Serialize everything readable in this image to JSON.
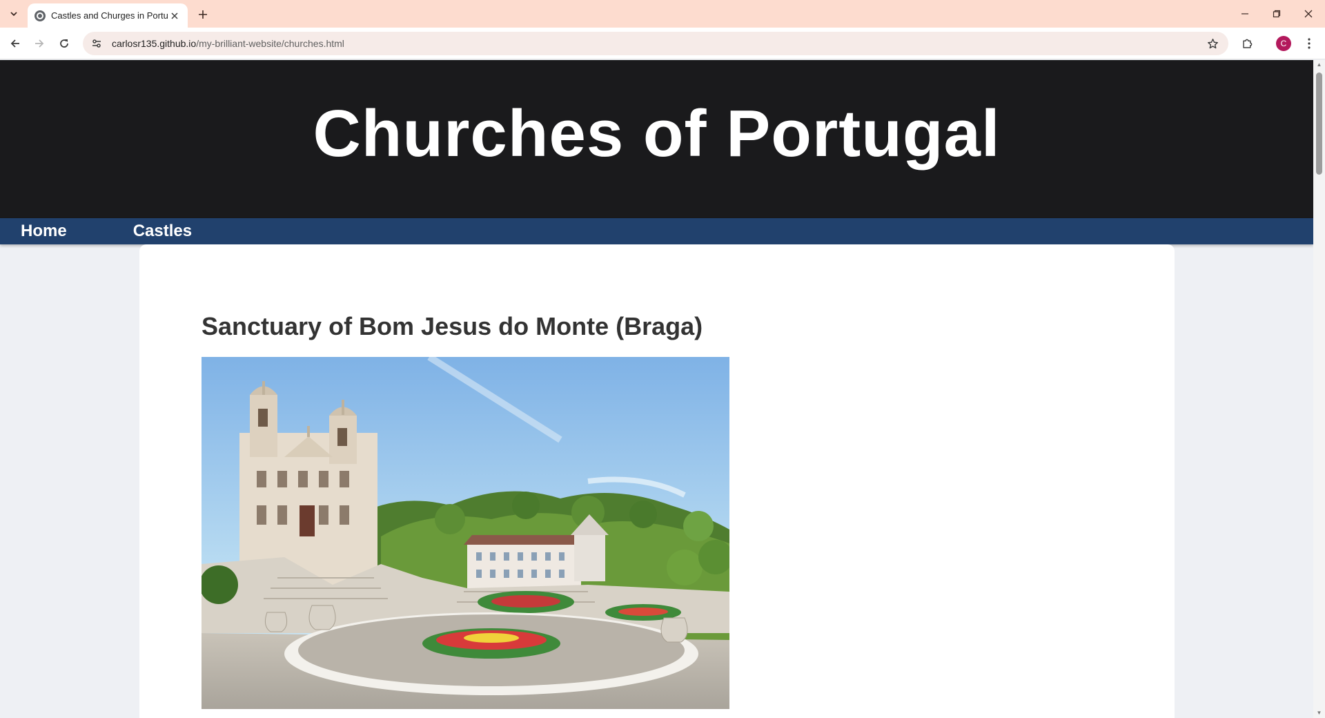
{
  "browser": {
    "tab_title": "Castles and Churges in Portugal",
    "url_host": "carlosr135.github.io",
    "url_path": "/my-brilliant-website/churches.html",
    "profile_initial": "C",
    "accent_color": "#fddccf"
  },
  "page": {
    "title": "Churches of Portugal",
    "nav": [
      {
        "label": "Home"
      },
      {
        "label": "Castles"
      }
    ],
    "section_heading": "Sanctuary of Bom Jesus do Monte (Braga)",
    "header_bg": "#1a1a1c",
    "nav_bg": "#21416d"
  },
  "icons": {
    "tab_list": "chevron-down-icon",
    "favicon": "globe-icon",
    "tab_close": "close-icon",
    "new_tab": "plus-icon",
    "minimize": "minimize-icon",
    "restore": "restore-icon",
    "close_window": "close-icon",
    "back": "arrow-left-icon",
    "forward": "arrow-right-icon",
    "reload": "reload-icon",
    "site_info": "tune-icon",
    "bookmark": "star-icon",
    "extensions": "puzzle-icon",
    "menu": "kebab-menu-icon"
  }
}
